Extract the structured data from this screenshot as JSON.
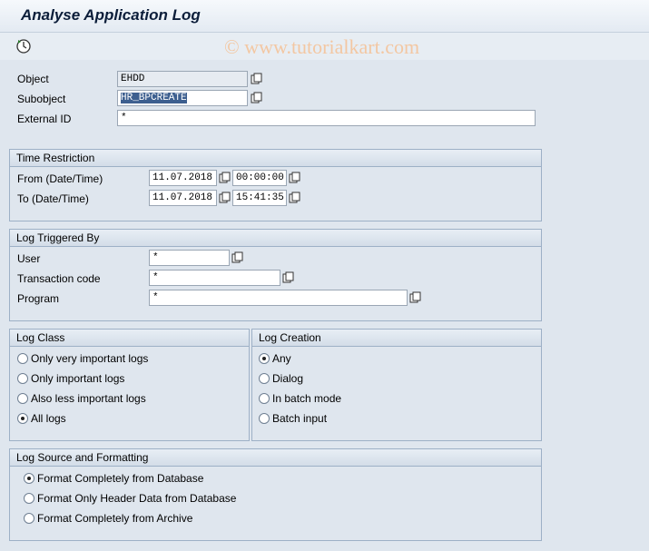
{
  "window": {
    "title": "Analyse Application Log",
    "watermark": "© www.tutorialkart.com"
  },
  "toolbar": {
    "execute_icon": "execute-clock-icon"
  },
  "header_fields": {
    "object": {
      "label": "Object",
      "value": "EHDD"
    },
    "subobject": {
      "label": "Subobject",
      "value": "HR_BPCREATE"
    },
    "external_id": {
      "label": "External ID",
      "value": "*"
    }
  },
  "time_restriction": {
    "title": "Time Restriction",
    "from": {
      "label": "From (Date/Time)",
      "date": "11.07.2018",
      "time": "00:00:00"
    },
    "to": {
      "label": "To (Date/Time)",
      "date": "11.07.2018",
      "time": "15:41:35"
    }
  },
  "log_triggered_by": {
    "title": "Log Triggered By",
    "user": {
      "label": "User",
      "value": "*"
    },
    "tcode": {
      "label": "Transaction code",
      "value": "*"
    },
    "program": {
      "label": "Program",
      "value": "*"
    }
  },
  "log_class": {
    "title": "Log Class",
    "options": [
      {
        "label": "Only very important logs",
        "selected": false
      },
      {
        "label": "Only important logs",
        "selected": false
      },
      {
        "label": "Also less important logs",
        "selected": false
      },
      {
        "label": "All logs",
        "selected": true
      }
    ]
  },
  "log_creation": {
    "title": "Log Creation",
    "options": [
      {
        "label": "Any",
        "selected": true
      },
      {
        "label": "Dialog",
        "selected": false
      },
      {
        "label": "In batch mode",
        "selected": false
      },
      {
        "label": "Batch input",
        "selected": false
      }
    ]
  },
  "log_source": {
    "title": "Log Source and Formatting",
    "options": [
      {
        "label": "Format Completely from Database",
        "selected": true
      },
      {
        "label": "Format Only Header Data from Database",
        "selected": false
      },
      {
        "label": "Format Completely from Archive",
        "selected": false
      }
    ]
  },
  "colors": {
    "background": "#dfe6ee",
    "title": "#0c1e3a",
    "group_border": "#9db0c6",
    "selection": "#3d5f8f"
  }
}
